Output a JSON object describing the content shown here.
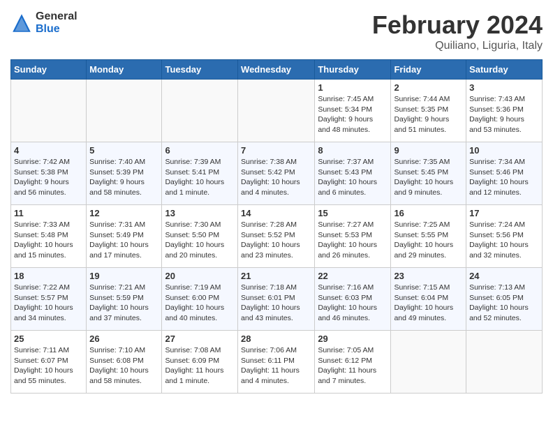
{
  "header": {
    "logo_general": "General",
    "logo_blue": "Blue",
    "title": "February 2024",
    "subtitle": "Quiliano, Liguria, Italy"
  },
  "columns": [
    "Sunday",
    "Monday",
    "Tuesday",
    "Wednesday",
    "Thursday",
    "Friday",
    "Saturday"
  ],
  "weeks": [
    [
      {
        "day": "",
        "info": ""
      },
      {
        "day": "",
        "info": ""
      },
      {
        "day": "",
        "info": ""
      },
      {
        "day": "",
        "info": ""
      },
      {
        "day": "1",
        "info": "Sunrise: 7:45 AM\nSunset: 5:34 PM\nDaylight: 9 hours\nand 48 minutes."
      },
      {
        "day": "2",
        "info": "Sunrise: 7:44 AM\nSunset: 5:35 PM\nDaylight: 9 hours\nand 51 minutes."
      },
      {
        "day": "3",
        "info": "Sunrise: 7:43 AM\nSunset: 5:36 PM\nDaylight: 9 hours\nand 53 minutes."
      }
    ],
    [
      {
        "day": "4",
        "info": "Sunrise: 7:42 AM\nSunset: 5:38 PM\nDaylight: 9 hours\nand 56 minutes."
      },
      {
        "day": "5",
        "info": "Sunrise: 7:40 AM\nSunset: 5:39 PM\nDaylight: 9 hours\nand 58 minutes."
      },
      {
        "day": "6",
        "info": "Sunrise: 7:39 AM\nSunset: 5:41 PM\nDaylight: 10 hours\nand 1 minute."
      },
      {
        "day": "7",
        "info": "Sunrise: 7:38 AM\nSunset: 5:42 PM\nDaylight: 10 hours\nand 4 minutes."
      },
      {
        "day": "8",
        "info": "Sunrise: 7:37 AM\nSunset: 5:43 PM\nDaylight: 10 hours\nand 6 minutes."
      },
      {
        "day": "9",
        "info": "Sunrise: 7:35 AM\nSunset: 5:45 PM\nDaylight: 10 hours\nand 9 minutes."
      },
      {
        "day": "10",
        "info": "Sunrise: 7:34 AM\nSunset: 5:46 PM\nDaylight: 10 hours\nand 12 minutes."
      }
    ],
    [
      {
        "day": "11",
        "info": "Sunrise: 7:33 AM\nSunset: 5:48 PM\nDaylight: 10 hours\nand 15 minutes."
      },
      {
        "day": "12",
        "info": "Sunrise: 7:31 AM\nSunset: 5:49 PM\nDaylight: 10 hours\nand 17 minutes."
      },
      {
        "day": "13",
        "info": "Sunrise: 7:30 AM\nSunset: 5:50 PM\nDaylight: 10 hours\nand 20 minutes."
      },
      {
        "day": "14",
        "info": "Sunrise: 7:28 AM\nSunset: 5:52 PM\nDaylight: 10 hours\nand 23 minutes."
      },
      {
        "day": "15",
        "info": "Sunrise: 7:27 AM\nSunset: 5:53 PM\nDaylight: 10 hours\nand 26 minutes."
      },
      {
        "day": "16",
        "info": "Sunrise: 7:25 AM\nSunset: 5:55 PM\nDaylight: 10 hours\nand 29 minutes."
      },
      {
        "day": "17",
        "info": "Sunrise: 7:24 AM\nSunset: 5:56 PM\nDaylight: 10 hours\nand 32 minutes."
      }
    ],
    [
      {
        "day": "18",
        "info": "Sunrise: 7:22 AM\nSunset: 5:57 PM\nDaylight: 10 hours\nand 34 minutes."
      },
      {
        "day": "19",
        "info": "Sunrise: 7:21 AM\nSunset: 5:59 PM\nDaylight: 10 hours\nand 37 minutes."
      },
      {
        "day": "20",
        "info": "Sunrise: 7:19 AM\nSunset: 6:00 PM\nDaylight: 10 hours\nand 40 minutes."
      },
      {
        "day": "21",
        "info": "Sunrise: 7:18 AM\nSunset: 6:01 PM\nDaylight: 10 hours\nand 43 minutes."
      },
      {
        "day": "22",
        "info": "Sunrise: 7:16 AM\nSunset: 6:03 PM\nDaylight: 10 hours\nand 46 minutes."
      },
      {
        "day": "23",
        "info": "Sunrise: 7:15 AM\nSunset: 6:04 PM\nDaylight: 10 hours\nand 49 minutes."
      },
      {
        "day": "24",
        "info": "Sunrise: 7:13 AM\nSunset: 6:05 PM\nDaylight: 10 hours\nand 52 minutes."
      }
    ],
    [
      {
        "day": "25",
        "info": "Sunrise: 7:11 AM\nSunset: 6:07 PM\nDaylight: 10 hours\nand 55 minutes."
      },
      {
        "day": "26",
        "info": "Sunrise: 7:10 AM\nSunset: 6:08 PM\nDaylight: 10 hours\nand 58 minutes."
      },
      {
        "day": "27",
        "info": "Sunrise: 7:08 AM\nSunset: 6:09 PM\nDaylight: 11 hours\nand 1 minute."
      },
      {
        "day": "28",
        "info": "Sunrise: 7:06 AM\nSunset: 6:11 PM\nDaylight: 11 hours\nand 4 minutes."
      },
      {
        "day": "29",
        "info": "Sunrise: 7:05 AM\nSunset: 6:12 PM\nDaylight: 11 hours\nand 7 minutes."
      },
      {
        "day": "",
        "info": ""
      },
      {
        "day": "",
        "info": ""
      }
    ]
  ]
}
